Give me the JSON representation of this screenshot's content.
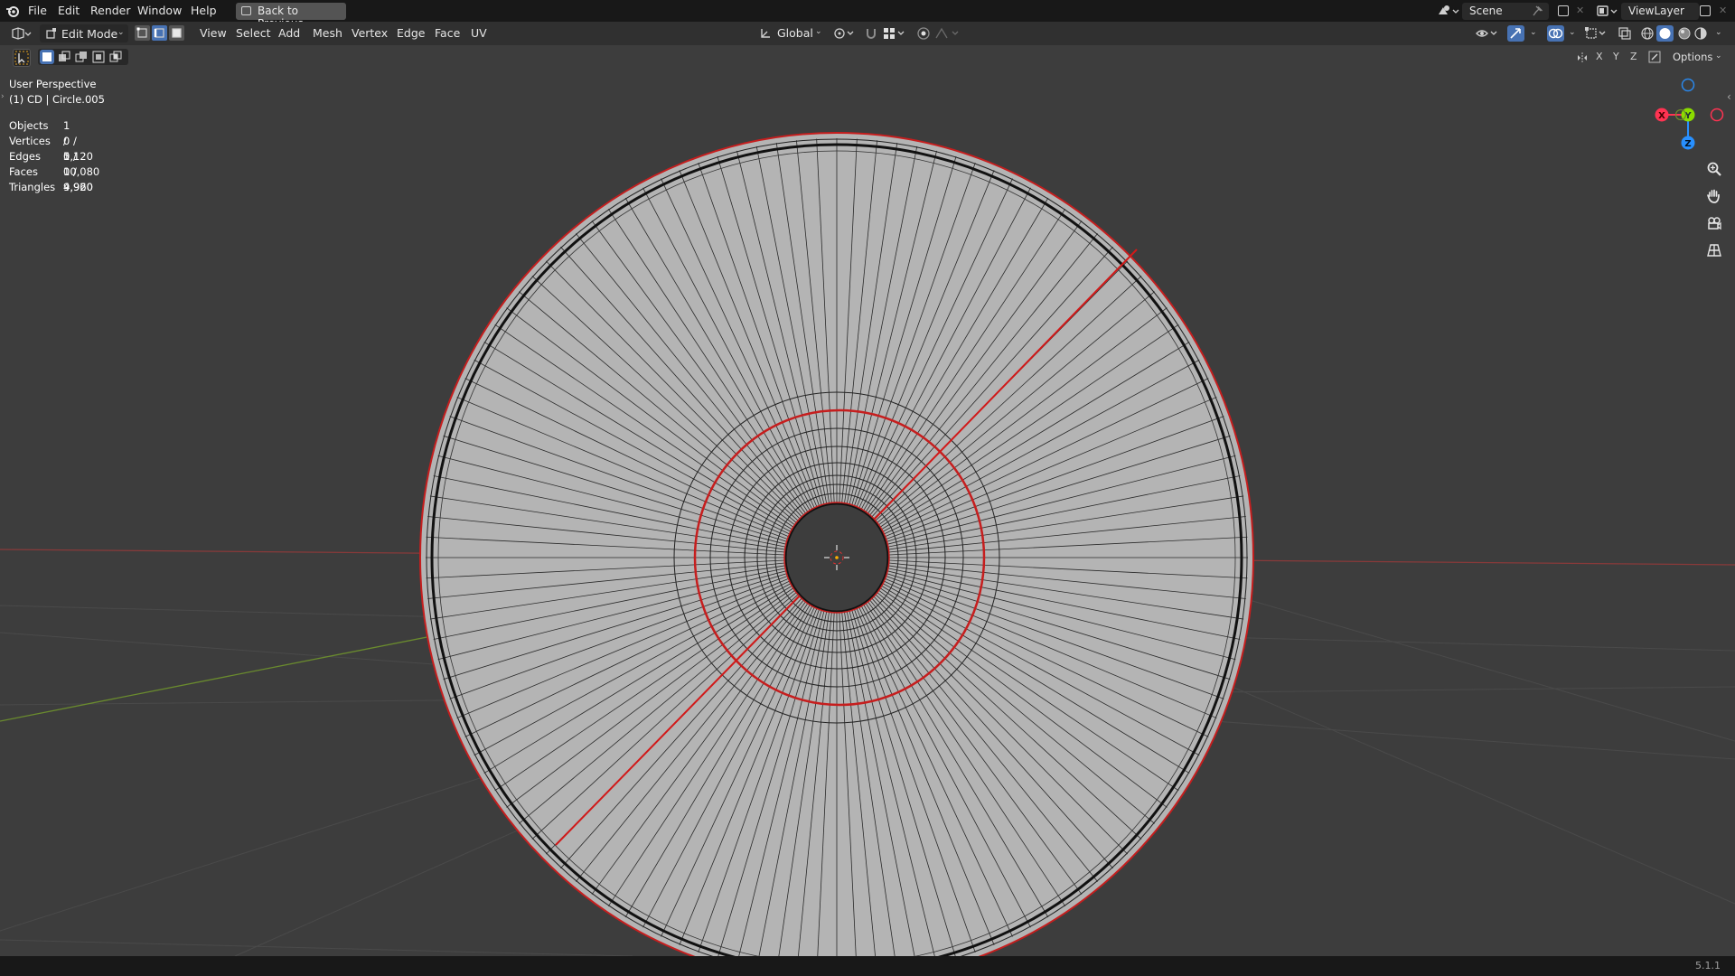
{
  "menu": {
    "items": [
      "File",
      "Edit",
      "Render",
      "Window",
      "Help"
    ],
    "back_label": "Back to Previous",
    "scene": "Scene",
    "view_layer": "ViewLayer"
  },
  "header": {
    "mode": "Edit Mode",
    "menus": [
      "View",
      "Select",
      "Add",
      "Mesh",
      "Vertex",
      "Edge",
      "Face",
      "UV"
    ],
    "orientation": "Global",
    "options_label": "Options",
    "axes": [
      "X",
      "Y",
      "Z"
    ]
  },
  "viewport": {
    "perspective": "User Perspective",
    "object": "(1) CD | Circle.005",
    "stats": [
      {
        "label": "Objects",
        "value": "1 / 1"
      },
      {
        "label": "Vertices",
        "value": "0 / 5,120"
      },
      {
        "label": "Edges",
        "value": "0 / 10,080"
      },
      {
        "label": "Faces",
        "value": "0 / 4,960"
      },
      {
        "label": "Triangles",
        "value": "9,920"
      }
    ]
  },
  "gizmo": {
    "x": "X",
    "y": "Y",
    "z": "Z"
  },
  "status": {
    "version": "5.1.1"
  },
  "colors": {
    "seam": "#e01818",
    "mesh": "#b4b4b4",
    "accent": "#4772b3",
    "gizmo_x": "#ff3352",
    "gizmo_y": "#8bdc00",
    "gizmo_z": "#2890ff"
  }
}
